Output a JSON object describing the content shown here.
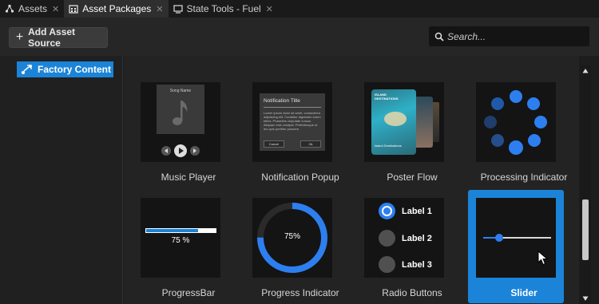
{
  "tabs": [
    {
      "label": "Assets",
      "icon": "nodes-icon",
      "active": false
    },
    {
      "label": "Asset Packages",
      "icon": "package-icon",
      "active": true
    },
    {
      "label": "State Tools - Fuel",
      "icon": "monitor-icon",
      "active": false
    }
  ],
  "toolbar": {
    "add_label": "Add Asset Source",
    "search_placeholder": "Search..."
  },
  "tree": {
    "selected_label": "Factory Content"
  },
  "cards": [
    {
      "label": "Music Player",
      "detail": "Song Name"
    },
    {
      "label": "Notification Popup",
      "detail_title": "Notification Title",
      "detail_body": "Lorem ipsum dolor sit amet, consectetur adipiscing elit. Curabitur dignissim lorem tellus. Phasellus vulputate cursus. Aliquam erat volutpat. Pellentesque ut leo quis porttitor posuere.",
      "cancel": "Cancel",
      "ok": "Ok"
    },
    {
      "label": "Poster Flow",
      "detail_title": "ISLAND DESTINATIONS",
      "detail_sub": "Island Destinations"
    },
    {
      "label": "Processing Indicator"
    },
    {
      "label": "ProgressBar",
      "progress_text": "75 %",
      "progress": 0.75
    },
    {
      "label": "Progress Indicator",
      "progress_text": "75%",
      "progress": 0.75
    },
    {
      "label": "Radio Buttons",
      "options": [
        "Label 1",
        "Label 2",
        "Label 3"
      ],
      "selected_index": 0
    },
    {
      "label": "Slider",
      "value": 0.23,
      "selected": true
    }
  ],
  "colors": {
    "accent": "#1b84d8",
    "indicator_blue": "#2d7ff0"
  }
}
